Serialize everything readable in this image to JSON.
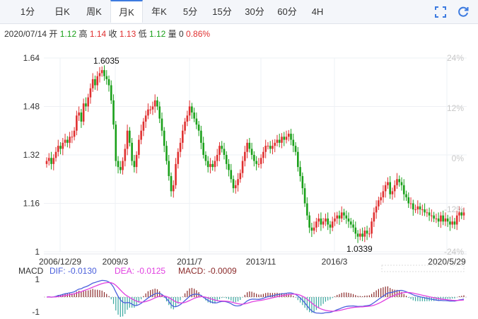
{
  "tabs": [
    {
      "label": "1分"
    },
    {
      "label": "日K"
    },
    {
      "label": "周K"
    },
    {
      "label": "月K"
    },
    {
      "label": "年K"
    },
    {
      "label": "5分"
    },
    {
      "label": "15分"
    },
    {
      "label": "30分"
    },
    {
      "label": "60分"
    },
    {
      "label": "4H"
    }
  ],
  "active_tab": "月K",
  "toolbar": {
    "fullscreen_icon": "fullscreen-icon",
    "refresh_icon": "refresh-icon"
  },
  "info": {
    "date": "2020/07/14",
    "open_label": "开",
    "open": "1.12",
    "high_label": "高",
    "high": "1.14",
    "close_label": "收",
    "close": "1.13",
    "low_label": "低",
    "low": "1.12",
    "vol_label": "量",
    "vol": "0",
    "change": "0.86%"
  },
  "colors": {
    "up": "#e03030",
    "down": "#1aa01a",
    "dif": "#4a5fdc",
    "dea": "#e040e0",
    "macd": "#8b2a2a"
  },
  "chart_data": [
    {
      "type": "candlestick",
      "y_ticks": [
        "1.64",
        "1.48",
        "1.32",
        "1.16",
        "1"
      ],
      "ylim": [
        1.0,
        1.64
      ],
      "pct_ticks": [
        "24%",
        "12%",
        "0%",
        "-12%",
        "-24%"
      ],
      "x_ticks": [
        "2006/12/29",
        "2009/3",
        "2011/7",
        "2013/11",
        "2016/3",
        "2020/5/29"
      ],
      "annotations": [
        {
          "label": "1.6035",
          "value": 1.6035,
          "date": "2008/3"
        },
        {
          "label": "1.0339",
          "value": 1.0339,
          "date": "2016/10"
        }
      ],
      "monthly_close": [
        1.3,
        1.31,
        1.29,
        1.31,
        1.33,
        1.35,
        1.34,
        1.36,
        1.37,
        1.36,
        1.38,
        1.38,
        1.4,
        1.45,
        1.46,
        1.43,
        1.49,
        1.48,
        1.51,
        1.54,
        1.57,
        1.55,
        1.58,
        1.59,
        1.6,
        1.58,
        1.57,
        1.55,
        1.5,
        1.42,
        1.3,
        1.28,
        1.27,
        1.3,
        1.34,
        1.4,
        1.36,
        1.3,
        1.28,
        1.32,
        1.37,
        1.4,
        1.43,
        1.45,
        1.47,
        1.47,
        1.48,
        1.5,
        1.48,
        1.44,
        1.4,
        1.35,
        1.3,
        1.25,
        1.2,
        1.22,
        1.29,
        1.33,
        1.36,
        1.4,
        1.43,
        1.45,
        1.48,
        1.46,
        1.44,
        1.42,
        1.4,
        1.36,
        1.32,
        1.3,
        1.28,
        1.29,
        1.28,
        1.3,
        1.32,
        1.35,
        1.34,
        1.32,
        1.29,
        1.27,
        1.24,
        1.21,
        1.22,
        1.24,
        1.26,
        1.3,
        1.33,
        1.36,
        1.34,
        1.32,
        1.3,
        1.29,
        1.29,
        1.31,
        1.33,
        1.35,
        1.35,
        1.34,
        1.35,
        1.36,
        1.37,
        1.36,
        1.38,
        1.37,
        1.38,
        1.39,
        1.37,
        1.35,
        1.33,
        1.28,
        1.25,
        1.21,
        1.16,
        1.12,
        1.08,
        1.07,
        1.08,
        1.1,
        1.11,
        1.09,
        1.1,
        1.11,
        1.09,
        1.08,
        1.1,
        1.11,
        1.12,
        1.11,
        1.13,
        1.12,
        1.11,
        1.1,
        1.09,
        1.08,
        1.06,
        1.05,
        1.06,
        1.05,
        1.07,
        1.06,
        1.06,
        1.1,
        1.13,
        1.15,
        1.17,
        1.18,
        1.2,
        1.22,
        1.23,
        1.19,
        1.2,
        1.22,
        1.24,
        1.23,
        1.22,
        1.19,
        1.18,
        1.16,
        1.16,
        1.14,
        1.14,
        1.15,
        1.14,
        1.14,
        1.13,
        1.13,
        1.12,
        1.12,
        1.11,
        1.11,
        1.1,
        1.12,
        1.1,
        1.11,
        1.1,
        1.09,
        1.1,
        1.09,
        1.12,
        1.13,
        1.12,
        1.13
      ]
    },
    {
      "type": "macd",
      "legend": {
        "name": "MACD",
        "dif_label": "DIF: -0.0130",
        "dea_label": "DEA: -0.0125",
        "macd_label": "MACD: -0.0009"
      },
      "y_ticks": [
        "1",
        "-1"
      ]
    }
  ]
}
